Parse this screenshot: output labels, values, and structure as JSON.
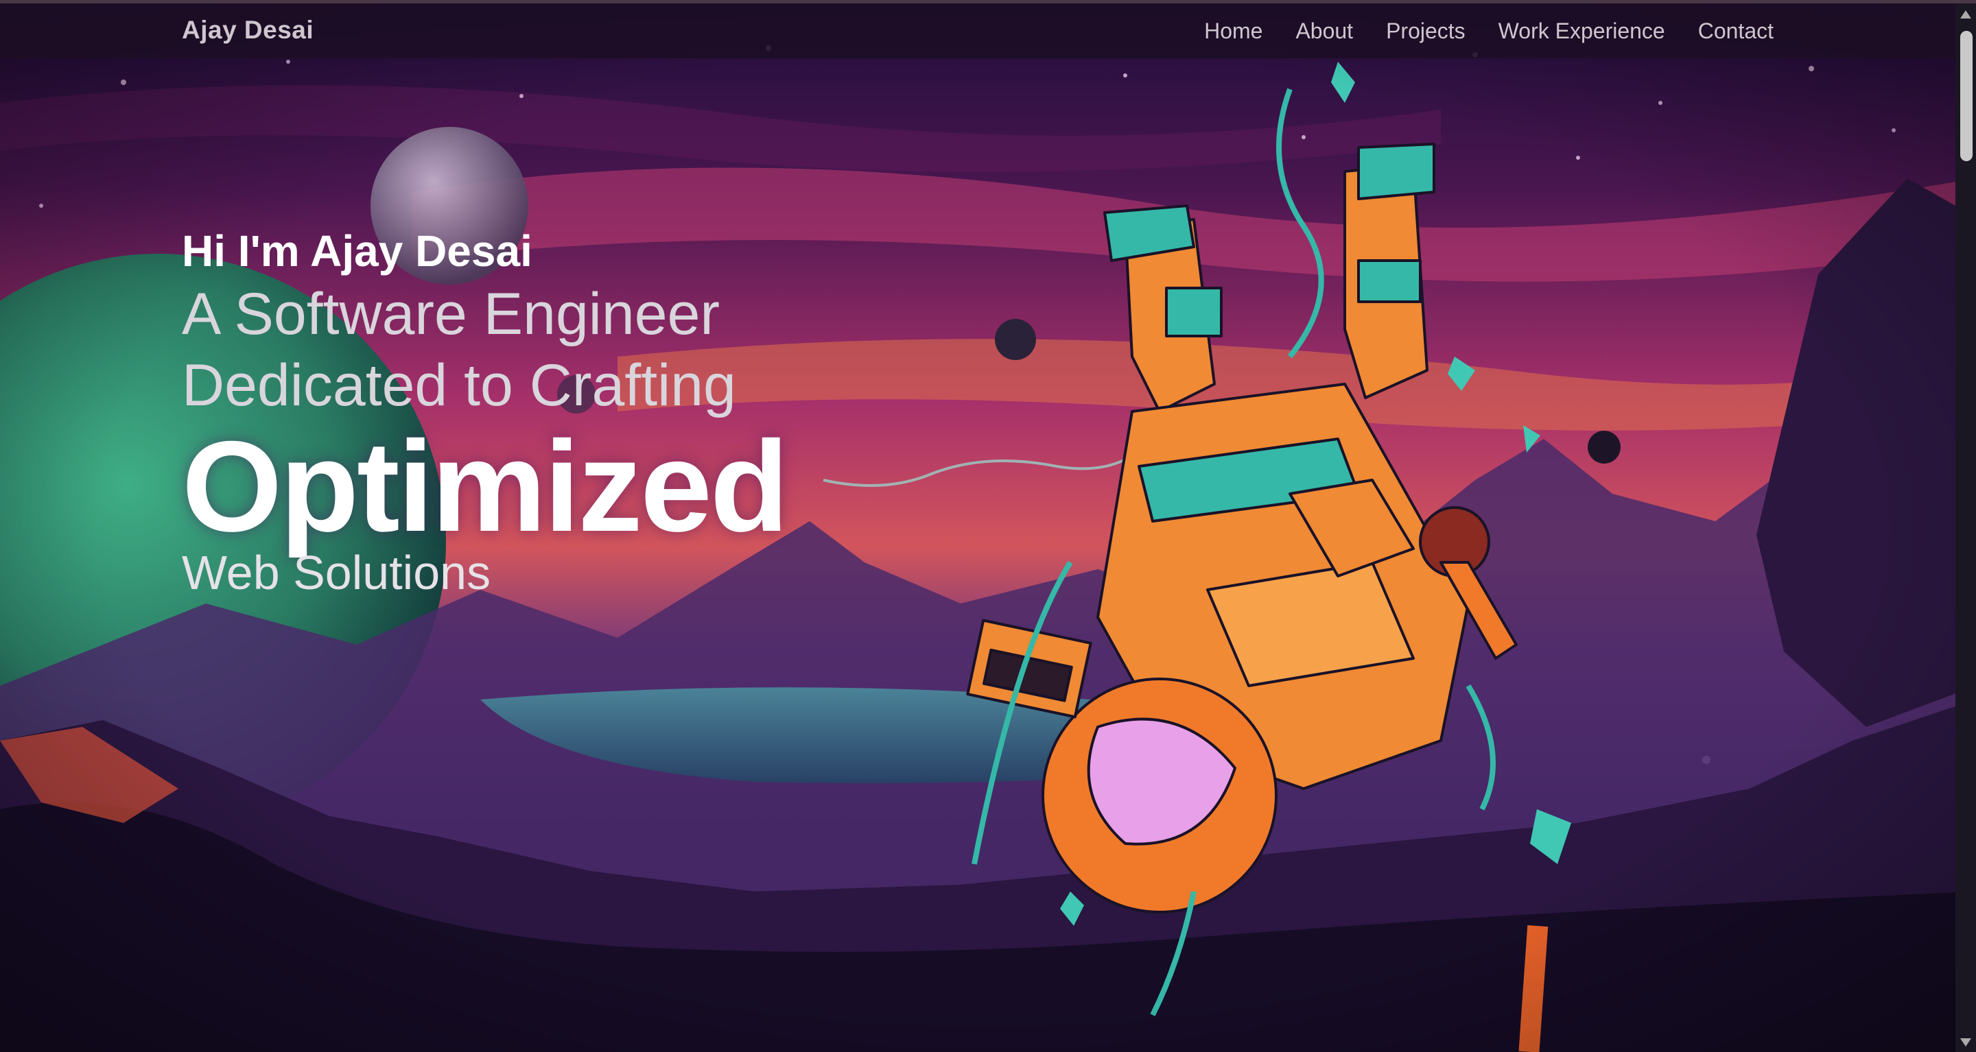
{
  "header": {
    "brand": "Ajay Desai",
    "nav": [
      "Home",
      "About",
      "Projects",
      "Work Experience",
      "Contact"
    ]
  },
  "hero": {
    "greeting": "Hi I'm Ajay Desai",
    "line1": "A Software Engineer",
    "line2": "Dedicated to Crafting",
    "highlight": "Optimized",
    "line3": "Web Solutions"
  },
  "colors": {
    "sky_top": "#1e0d3a",
    "sky_mid": "#b83a6a",
    "sky_horizon": "#e0704a",
    "ground": "#20123e",
    "suit_orange": "#f07a2a",
    "suit_teal": "#35b8a8",
    "planet_green": "#2c8a6a"
  },
  "icons": [
    "astronaut-illustration",
    "planet-icon"
  ]
}
